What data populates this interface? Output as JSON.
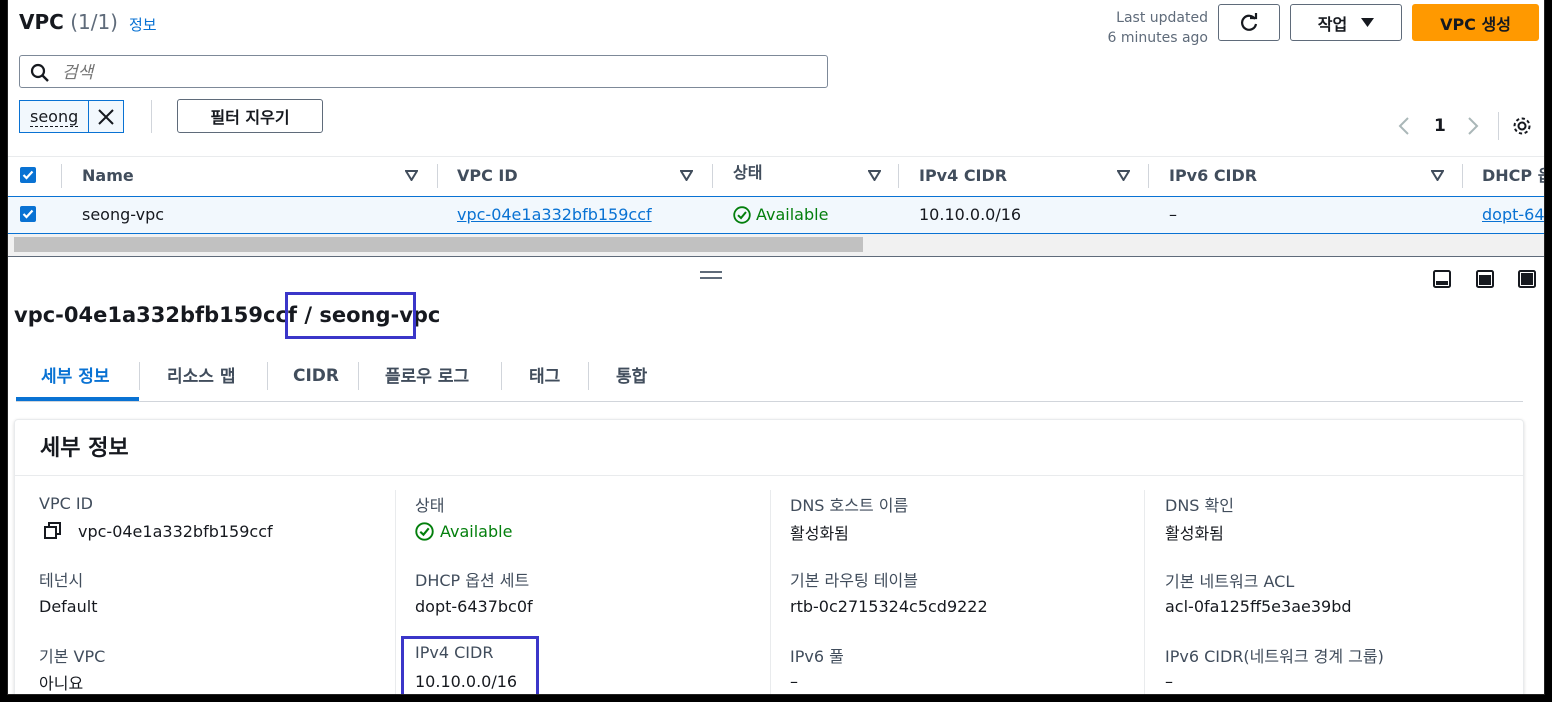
{
  "header": {
    "title": "VPC",
    "count": "(1/1)",
    "info_link": "정보",
    "last_updated_label": "Last updated",
    "last_updated_value": "6 minutes ago",
    "actions_label": "작업",
    "create_label": "VPC 생성"
  },
  "search": {
    "placeholder": "검색"
  },
  "filter": {
    "token": "seong",
    "clear_label": "필터 지우기"
  },
  "pagination": {
    "page": "1"
  },
  "table": {
    "columns": [
      "Name",
      "VPC ID",
      "상태",
      "IPv4 CIDR",
      "IPv6 CIDR",
      "DHCP 옵"
    ],
    "row": {
      "name": "seong-vpc",
      "vpc_id": "vpc-04e1a332bfb159ccf",
      "state": "Available",
      "ipv4": "10.10.0.0/16",
      "ipv6": "–",
      "dhcp": "dopt-64"
    }
  },
  "detail": {
    "vpc_id": "vpc-04e1a332bfb159ccf",
    "separator": "/",
    "name": "seong-vpc",
    "tabs": [
      "세부 정보",
      "리소스 맵",
      "CIDR",
      "플로우 로그",
      "태그",
      "통합"
    ],
    "section_title": "세부 정보",
    "fields": {
      "vpc_id_label": "VPC ID",
      "vpc_id_value": "vpc-04e1a332bfb159ccf",
      "state_label": "상태",
      "state_value": "Available",
      "dns_hostnames_label": "DNS 호스트 이름",
      "dns_hostnames_value": "활성화됨",
      "dns_resolution_label": "DNS 확인",
      "dns_resolution_value": "활성화됨",
      "tenancy_label": "테넌시",
      "tenancy_value": "Default",
      "dhcp_label": "DHCP 옵션 세트",
      "dhcp_value": "dopt-6437bc0f",
      "main_rt_label": "기본 라우팅 테이블",
      "main_rt_value": "rtb-0c2715324c5cd9222",
      "main_acl_label": "기본 네트워크 ACL",
      "main_acl_value": "acl-0fa125ff5e3ae39bd",
      "default_vpc_label": "기본 VPC",
      "default_vpc_value": "아니요",
      "ipv4_label": "IPv4 CIDR",
      "ipv4_value": "10.10.0.0/16",
      "ipv6_pool_label": "IPv6 풀",
      "ipv6_pool_value": "–",
      "ipv6_cidr_label": "IPv6 CIDR(네트워크 경계 그룹)",
      "ipv6_cidr_value": "–"
    }
  },
  "colors": {
    "primary": "#ff9900",
    "link": "#0972d3",
    "success": "#037f0c",
    "highlight": "#3b36c9"
  },
  "icons": [
    "refresh-icon",
    "caret-down-icon",
    "search-icon",
    "close-icon",
    "chevron-left-icon",
    "chevron-right-icon",
    "settings-icon",
    "checkbox-icon",
    "status-ok-icon",
    "copy-icon",
    "drag-handle-icon",
    "split-bottom-icon",
    "split-side-icon",
    "split-full-icon"
  ]
}
